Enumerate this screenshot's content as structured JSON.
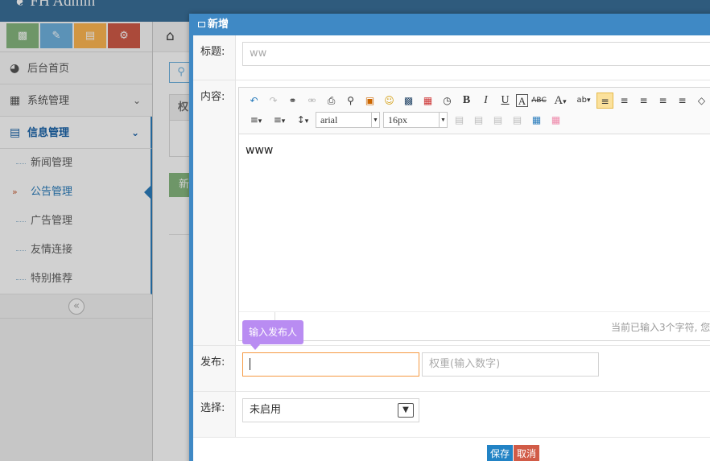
{
  "app": {
    "brand": "FH Admin"
  },
  "sidebar": {
    "shortcuts": [
      {
        "icon": "signal-icon",
        "glyph": "📶"
      },
      {
        "icon": "pencil-icon",
        "glyph": "✎"
      },
      {
        "icon": "book-icon",
        "glyph": "📖"
      },
      {
        "icon": "cogs-icon",
        "glyph": "⚙"
      }
    ],
    "items": [
      {
        "label": "后台首页",
        "icon": "dashboard-icon"
      },
      {
        "label": "系统管理",
        "icon": "film-icon"
      },
      {
        "label": "信息管理",
        "icon": "list-icon"
      }
    ],
    "submenu": [
      "新闻管理",
      "公告管理",
      "广告管理",
      "友情连接",
      "特别推荐"
    ],
    "active_sub": "公告管理"
  },
  "background": {
    "table_header": "权",
    "button": "新"
  },
  "dialog": {
    "title": "新增",
    "title_label": "标题:",
    "title_placeholder": "ww",
    "content_label": "内容:",
    "font_family": "arial",
    "font_size": "16px",
    "content_text": "www",
    "char_count": "当前已输入3个字符, 您",
    "tooltip": "输入发布人",
    "publish_label": "发布:",
    "publisher_value": "",
    "weight_placeholder": "权重(输入数字)",
    "select_label": "选择:",
    "select_value": "未启用",
    "save": "保存",
    "cancel": "取消"
  }
}
